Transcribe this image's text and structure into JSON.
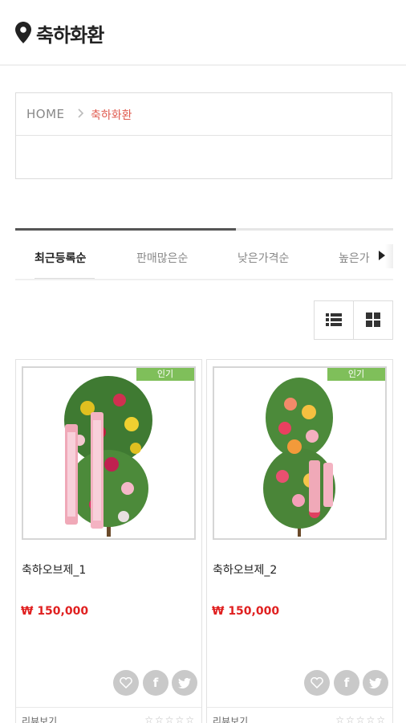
{
  "header": {
    "title": "축하화환",
    "icon": "location-pin-icon"
  },
  "breadcrumb": {
    "home": "HOME",
    "separator_icon": "chevron-right-icon",
    "current": "축하화환"
  },
  "sort_tabs": [
    {
      "label": "최근등록순",
      "active": true
    },
    {
      "label": "판매많은순",
      "active": false
    },
    {
      "label": "낮은가격순",
      "active": false
    },
    {
      "label": "높은가",
      "active": false
    }
  ],
  "view_toggle": {
    "list_icon": "list-view-icon",
    "grid_icon": "grid-view-icon"
  },
  "products": [
    {
      "badge": "인기",
      "name": "축하오브제_1",
      "price": "₩ 150,000",
      "review_label": "리뷰보기",
      "stars": "☆☆☆☆☆"
    },
    {
      "badge": "인기",
      "name": "축하오브제_2",
      "price": "₩ 150,000",
      "review_label": "리뷰보기",
      "stars": "☆☆☆☆☆"
    }
  ],
  "colors": {
    "accent_red": "#e02020",
    "breadcrumb_current": "#e05a4e",
    "badge_green": "#7fbf5a"
  }
}
